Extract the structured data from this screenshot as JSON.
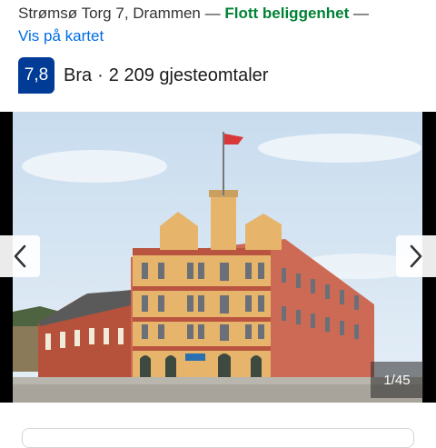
{
  "location": {
    "address": "Strømsø Torg 7, Drammen",
    "separator": "—",
    "highlight": "Flott beliggenhet",
    "trailing_separator": "—",
    "map_link": "Vis på kartet"
  },
  "rating": {
    "score": "7,8",
    "verdict": "Bra",
    "separator": "·",
    "reviews": "2 209 gjesteomtaler"
  },
  "gallery": {
    "counter": "1/45",
    "prev_icon": "chevron-left-icon",
    "next_icon": "chevron-right-icon"
  },
  "colors": {
    "link": "#006ce4",
    "location_highlight": "#008234",
    "score_badge": "#003b95"
  }
}
